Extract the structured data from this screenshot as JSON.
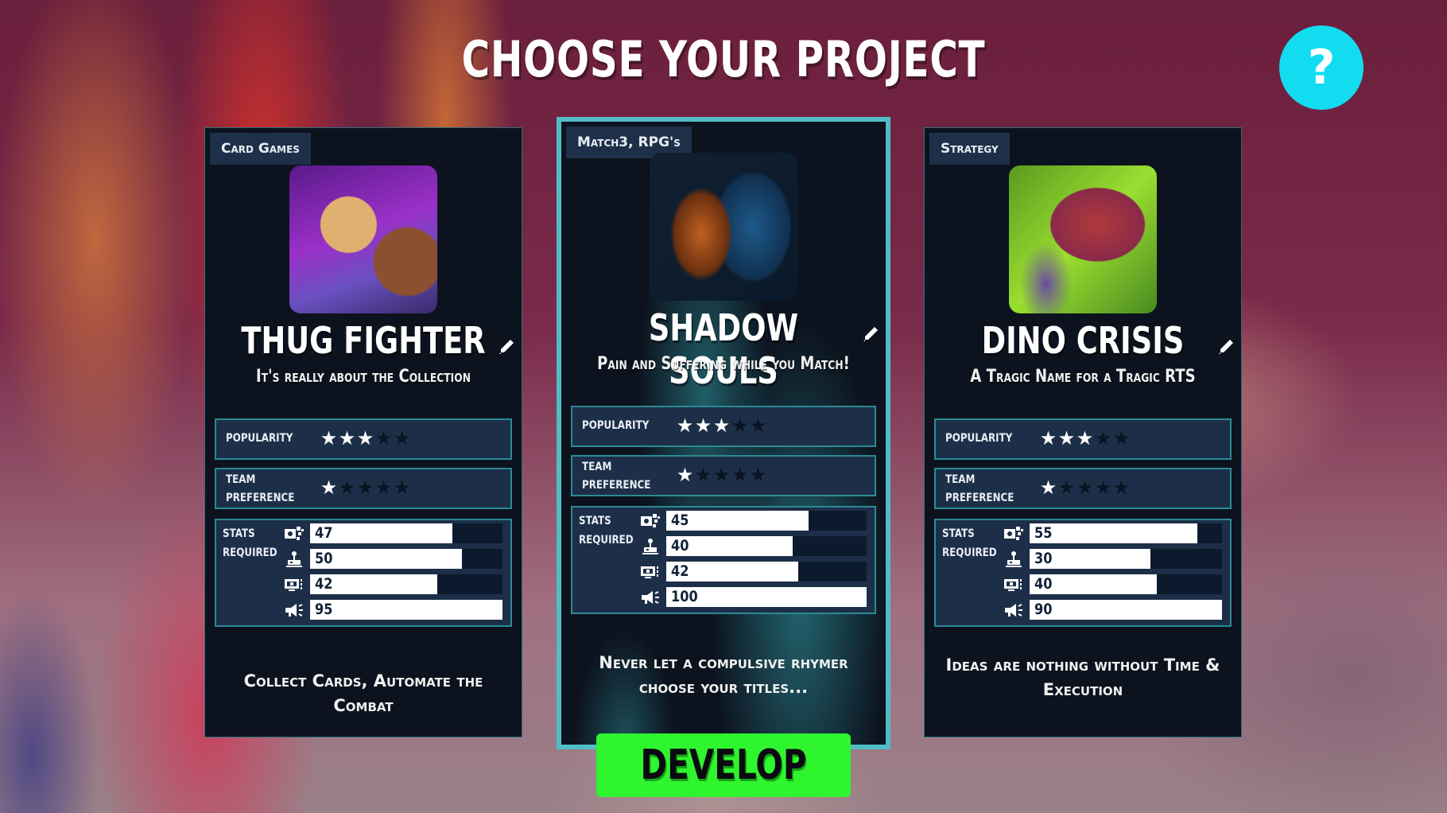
{
  "header": {
    "title": "CHOOSE YOUR PROJECT",
    "help_label": "?"
  },
  "labels": {
    "popularity": "POPULARITY",
    "team_pref_line1": "TEAM",
    "team_pref_line2": "PREFERENCE",
    "stats_line1": "STATS",
    "stats_line2": "REQUIRED"
  },
  "stat_icons": [
    "design-icon",
    "gameplay-joystick-icon",
    "tech-monitor-icon",
    "marketing-megaphone-icon"
  ],
  "projects": [
    {
      "genre": "Card Games",
      "name": "THUG FIGHTER",
      "tagline": "It's really about the Collection",
      "popularity_stars": 3,
      "team_preference_stars": 1,
      "max_stars": 5,
      "stats": [
        {
          "value": "47",
          "fill": 0.74
        },
        {
          "value": "50",
          "fill": 0.79
        },
        {
          "value": "42",
          "fill": 0.66
        },
        {
          "value": "95",
          "fill": 1.0
        }
      ],
      "description": "Collect Cards, Automate the Combat",
      "selected": false
    },
    {
      "genre": "Match3, RPG's",
      "name": "SHADOW SOULS",
      "tagline": "Pain and Suffering while you Match!",
      "popularity_stars": 3,
      "team_preference_stars": 1,
      "max_stars": 5,
      "stats": [
        {
          "value": "45",
          "fill": 0.71
        },
        {
          "value": "40",
          "fill": 0.63
        },
        {
          "value": "42",
          "fill": 0.66
        },
        {
          "value": "100",
          "fill": 1.0
        }
      ],
      "description": "Never let a compulsive rhymer choose your titles...",
      "selected": true
    },
    {
      "genre": "Strategy",
      "name": "DINO CRISIS",
      "tagline": "A Tragic Name for a Tragic RTS",
      "popularity_stars": 3,
      "team_preference_stars": 1,
      "max_stars": 5,
      "stats": [
        {
          "value": "55",
          "fill": 0.87
        },
        {
          "value": "30",
          "fill": 0.63
        },
        {
          "value": "40",
          "fill": 0.66
        },
        {
          "value": "90",
          "fill": 1.0
        }
      ],
      "description": "Ideas are nothing without Time & Execution",
      "selected": false
    }
  ],
  "develop_label": "DEVELOP",
  "colors": {
    "accent_cyan": "#13dcf0",
    "develop_green": "#2ff52f",
    "card_bg": "#0c131e",
    "box_bg": "#1d2f48",
    "box_border": "#2b8a94"
  }
}
